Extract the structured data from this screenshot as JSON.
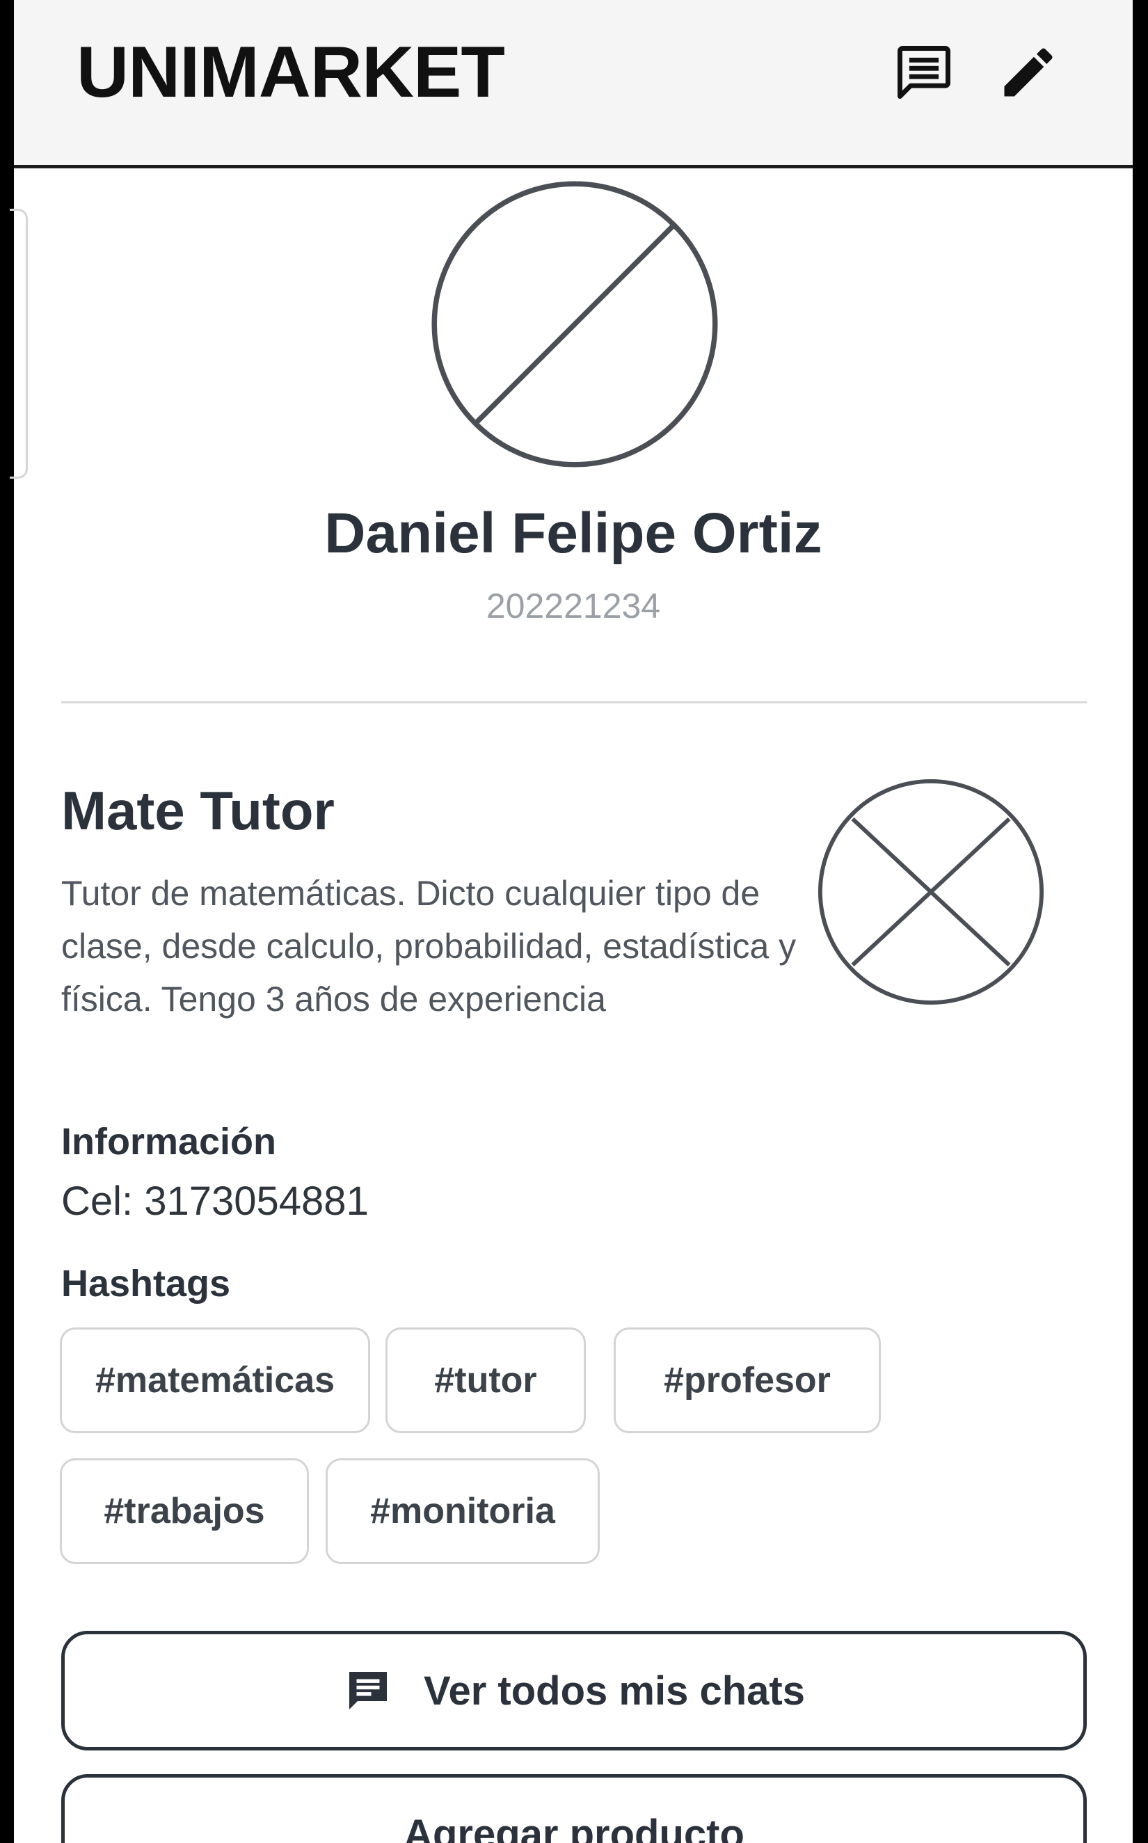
{
  "header": {
    "brand": "UNIMARKET",
    "chat_icon": "chat-bubble-icon",
    "edit_icon": "pencil-icon"
  },
  "profile": {
    "name": "Daniel Felipe Ortiz",
    "code": "202221234",
    "avatar_icon": "image-placeholder-icon"
  },
  "service": {
    "title": "Mate Tutor",
    "description": "Tutor de matemáticas.  Dicto cualquier tipo de clase, desde calculo, probabilidad, estadística y física. Tengo 3 años de experiencia",
    "image_icon": "image-placeholder-icon"
  },
  "info": {
    "label": "Información",
    "phone": "Cel: 3173054881"
  },
  "hashtags": {
    "label": "Hashtags",
    "items": [
      "#matemáticas",
      "#tutor",
      "#profesor",
      "#trabajos",
      "#monitoria"
    ]
  },
  "actions": {
    "chats_label": "Ver todos mis chats",
    "add_product_label": "Agregar producto"
  },
  "colors": {
    "header_bg": "#f5f5f5",
    "text_dark": "#2b323b",
    "text_muted": "#9aa0a6",
    "border": "#d2d4d6"
  }
}
